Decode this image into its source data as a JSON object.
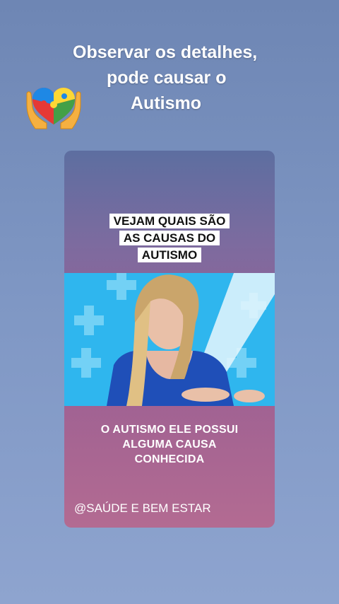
{
  "header": {
    "line1": "Observar os detalhes,",
    "line2": "pode causar o",
    "line3": "Autismo"
  },
  "emoji": {
    "icon": "puzzle-heart-hands-icon",
    "colors": [
      "#e53935",
      "#1e88e5",
      "#fdd835",
      "#43a047",
      "#f5b041"
    ]
  },
  "card": {
    "top_caption": [
      "VEJAM QUAIS SÃO",
      "AS CAUSAS DO",
      "AUTISMO"
    ],
    "video": {
      "description_icon": "video-frame-icon",
      "accent": "#2fb6ee"
    },
    "bottom_caption": [
      "O AUTISMO ELE POSSUI",
      "ALGUMA CAUSA",
      "CONHECIDA"
    ],
    "handle": "@SAÚDE E BEM ESTAR"
  }
}
